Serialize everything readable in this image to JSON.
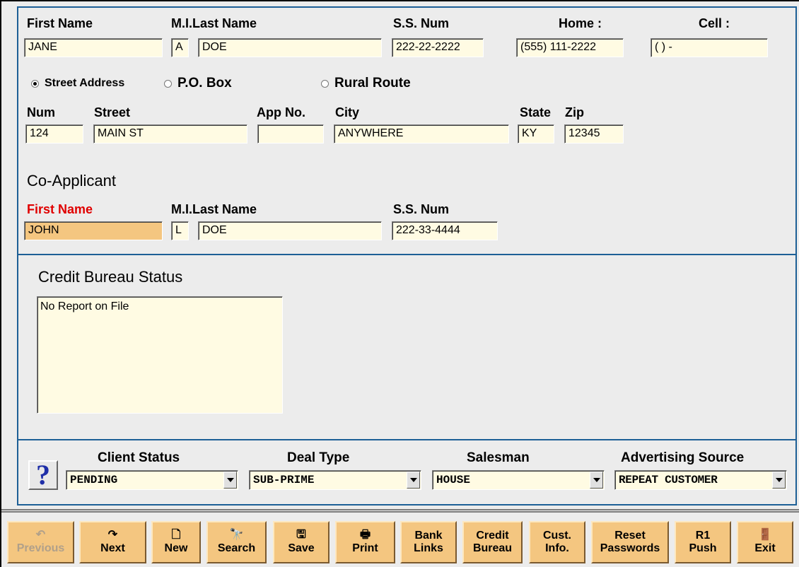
{
  "applicant": {
    "labels": {
      "first_name": "First Name",
      "mi_last_name": "M.I.Last Name",
      "ssn": "S.S. Num",
      "home": "Home :",
      "cell": "Cell :"
    },
    "values": {
      "first_name": "JANE",
      "mi": "A",
      "last_name": "DOE",
      "ssn": "222-22-2222",
      "home": "(555) 111-2222",
      "cell": "(  )    -"
    }
  },
  "address_type": {
    "options": [
      "Street Address",
      "P.O. Box",
      "Rural Route"
    ],
    "selected": "Street Address"
  },
  "address": {
    "labels": {
      "num": "Num",
      "street": "Street",
      "app_no": "App No.",
      "city": "City",
      "state": "State",
      "zip": "Zip"
    },
    "values": {
      "num": "124",
      "street": "MAIN ST",
      "app_no": "",
      "city": "ANYWHERE",
      "state": "KY",
      "zip": "12345"
    }
  },
  "co_applicant": {
    "title": "Co-Applicant",
    "labels": {
      "first_name": "First Name",
      "mi_last_name": "M.I.Last Name",
      "ssn": "S.S. Num"
    },
    "values": {
      "first_name": "JOHN",
      "mi": "L",
      "last_name": "DOE",
      "ssn": "222-33-4444"
    }
  },
  "credit": {
    "title": "Credit Bureau Status",
    "status_text": "No Report on File"
  },
  "status_bar": {
    "help_label": "?",
    "labels": {
      "client_status": "Client Status",
      "deal_type": "Deal Type",
      "salesman": "Salesman",
      "advertising_source": "Advertising Source"
    },
    "values": {
      "client_status": "PENDING",
      "deal_type": "SUB-PRIME",
      "salesman": "HOUSE",
      "advertising_source": "REPEAT CUSTOMER"
    }
  },
  "toolbar": {
    "buttons": [
      {
        "label": "Previous",
        "icon": "undo-icon",
        "glyph": "↶",
        "enabled": false
      },
      {
        "label": "Next",
        "icon": "redo-icon",
        "glyph": "↷",
        "enabled": true
      },
      {
        "label": "New",
        "icon": "new-document-icon",
        "glyph": "🗋",
        "enabled": true
      },
      {
        "label": "Search",
        "icon": "binoculars-icon",
        "glyph": "🔭",
        "enabled": true
      },
      {
        "label": "Save",
        "icon": "floppy-disk-icon",
        "glyph": "🖫",
        "enabled": true
      },
      {
        "label": "Print",
        "icon": "printer-icon",
        "glyph": "🖶",
        "enabled": true
      },
      {
        "label": "Bank",
        "label2": "Links",
        "enabled": true
      },
      {
        "label": "Credit",
        "label2": "Bureau",
        "enabled": true
      },
      {
        "label": "Cust.",
        "label2": "Info.",
        "enabled": true
      },
      {
        "label": "Reset",
        "label2": "Passwords",
        "enabled": true
      },
      {
        "label": "R1",
        "label2": "Push",
        "enabled": true
      },
      {
        "label": "Exit",
        "icon": "exit-door-icon",
        "glyph": "🚪",
        "enabled": true
      }
    ]
  },
  "colors": {
    "panel_border": "#1d5f96",
    "field_bg": "#fffbe3",
    "highlight_field": "#f4c680",
    "button_bg": "#f4c680",
    "required_label": "#e00000"
  }
}
